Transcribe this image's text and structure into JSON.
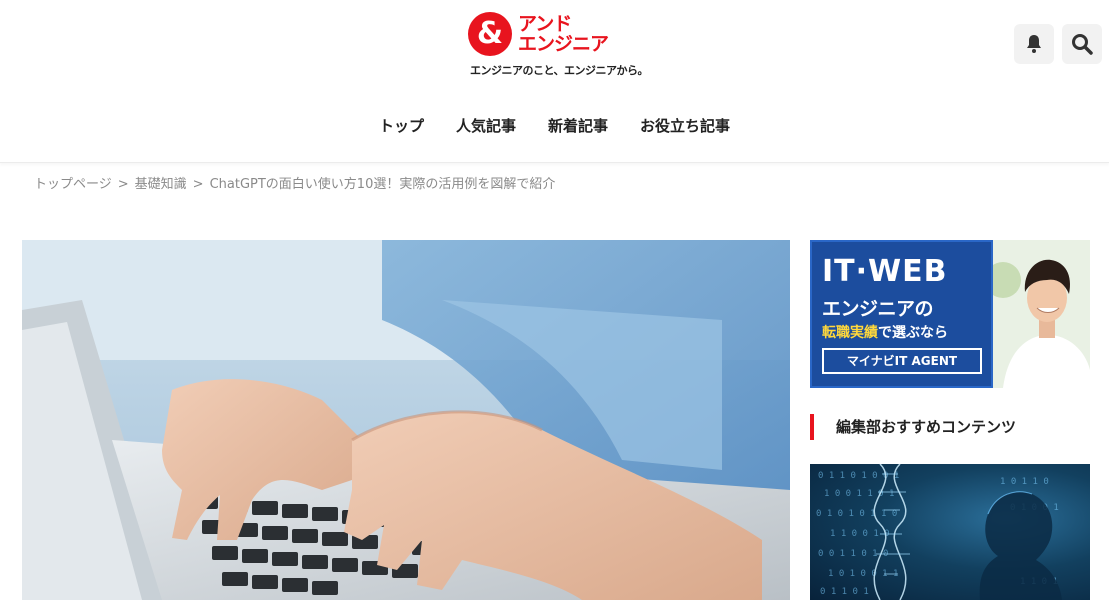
{
  "header": {
    "logo_mark": "&",
    "logo_line1": "アンド",
    "logo_line2": "エンジニア",
    "tagline": "エンジニアのこと、エンジニアから。",
    "bell_icon": "bell-icon",
    "search_icon": "search-icon"
  },
  "nav": {
    "items": [
      "トップ",
      "人気記事",
      "新着記事",
      "お役立ち記事"
    ]
  },
  "breadcrumb": {
    "items": [
      "トップページ",
      "基礎知識",
      "ChatGPTの面白い使い方10選！実際の活用例を図解で紹介"
    ],
    "separator": ">"
  },
  "sidebar": {
    "ad": {
      "line1": "IT·WEB",
      "line2": "エンジニアの",
      "line3_highlight": "転職実績",
      "line3_rest": "で選ぶなら",
      "badge": "マイナビIT AGENT"
    },
    "section_title": "編集部おすすめコンテンツ"
  },
  "colors": {
    "brand_red": "#e8141e",
    "ad_blue": "#1c4d9e",
    "ad_highlight": "#ffd83b"
  }
}
